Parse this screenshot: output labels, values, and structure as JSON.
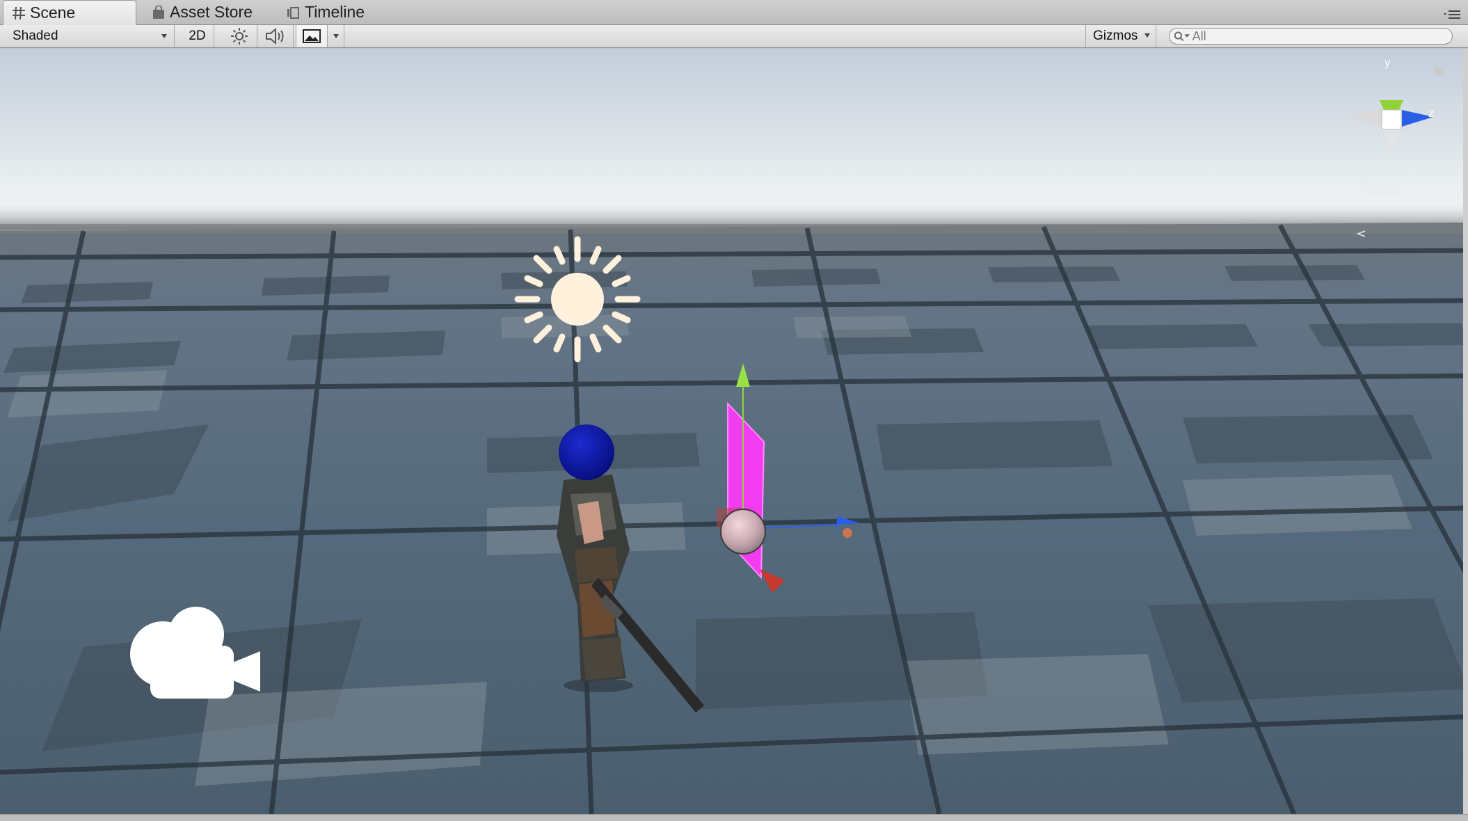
{
  "tabs": [
    {
      "label": "Scene",
      "icon": "grid-icon",
      "active": true
    },
    {
      "label": "Asset Store",
      "icon": "shopping-bag-icon",
      "active": false
    },
    {
      "label": "Timeline",
      "icon": "timeline-icon",
      "active": false
    }
  ],
  "toolbar": {
    "draw_mode": "Shaded",
    "mode_2d": "2D",
    "lighting_icon": "sun-toggle-icon",
    "audio_icon": "speaker-icon",
    "effects_icon": "image-effects-icon",
    "gizmos_label": "Gizmos",
    "search_placeholder": "All"
  },
  "orientation_gizmo": {
    "y_label": "y",
    "z_label": "z",
    "projection_label": "Persp",
    "lock_icon": "lock-icon"
  },
  "scene_objects": [
    {
      "name": "directional-light-gizmo",
      "icon": "sun-icon"
    },
    {
      "name": "main-camera-gizmo",
      "icon": "camera-icon"
    },
    {
      "name": "soldier-character"
    },
    {
      "name": "blue-sphere"
    },
    {
      "name": "selected-plane-magenta"
    }
  ],
  "colors": {
    "sky_top": "#c3ccda",
    "sky_horizon": "#eef2f3",
    "floor": "#4c5e6e",
    "selected_plane": "#f23cf0",
    "axis_y": "#8ed63a",
    "axis_z": "#2b5ee8",
    "axis_x": "#c8382e",
    "sphere": "#0c1aa0"
  }
}
